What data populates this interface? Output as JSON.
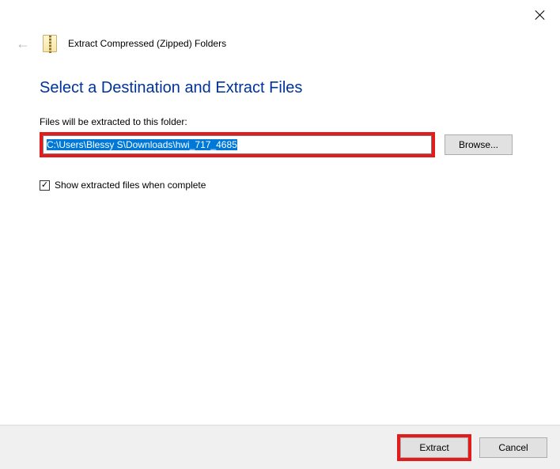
{
  "window": {
    "wizard_title": "Extract Compressed (Zipped) Folders"
  },
  "main": {
    "instruction": "Select a Destination and Extract Files",
    "destination_label": "Files will be extracted to this folder:",
    "destination_path": "C:\\Users\\Blessy S\\Downloads\\hwi_717_4685",
    "browse_label": "Browse...",
    "show_extracted_checked": true,
    "show_extracted_label": "Show extracted files when complete"
  },
  "footer": {
    "extract_label": "Extract",
    "cancel_label": "Cancel"
  },
  "icons": {
    "close": "close-icon",
    "back": "back-arrow-icon",
    "zip": "zip-folder-icon",
    "check": "✓"
  }
}
